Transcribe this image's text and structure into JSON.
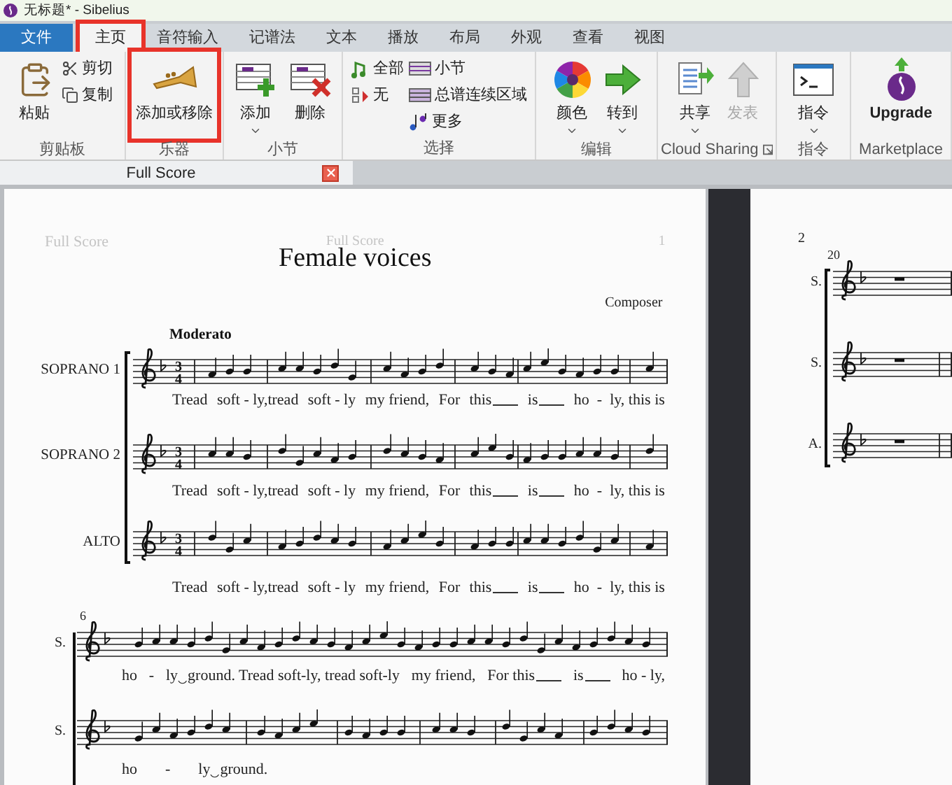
{
  "window": {
    "title": "无标题* - Sibelius"
  },
  "ribbon_tabs": [
    {
      "label": "文件",
      "kind": "file",
      "selected": false,
      "highlighted": false
    },
    {
      "label": "主页",
      "kind": "tab",
      "selected": true,
      "highlighted": true
    },
    {
      "label": "音符输入",
      "kind": "tab",
      "selected": false,
      "highlighted": false
    },
    {
      "label": "记谱法",
      "kind": "tab",
      "selected": false,
      "highlighted": false
    },
    {
      "label": "文本",
      "kind": "tab",
      "selected": false,
      "highlighted": false
    },
    {
      "label": "播放",
      "kind": "tab",
      "selected": false,
      "highlighted": false
    },
    {
      "label": "布局",
      "kind": "tab",
      "selected": false,
      "highlighted": false
    },
    {
      "label": "外观",
      "kind": "tab",
      "selected": false,
      "highlighted": false
    },
    {
      "label": "查看",
      "kind": "tab",
      "selected": false,
      "highlighted": false
    },
    {
      "label": "视图",
      "kind": "tab",
      "selected": false,
      "highlighted": false
    }
  ],
  "ribbon_groups": [
    {
      "label": "剪贴板",
      "items": [
        {
          "kind": "large",
          "label": "粘贴",
          "dropdown": false,
          "disabled": false,
          "highlighted": false
        },
        {
          "kind": "stack",
          "items": [
            {
              "label": "剪切"
            },
            {
              "label": "复制"
            }
          ]
        }
      ]
    },
    {
      "label": "乐器",
      "items": [
        {
          "kind": "large",
          "label": "添加或移除",
          "dropdown": false,
          "disabled": false,
          "highlighted": true
        }
      ]
    },
    {
      "label": "小节",
      "items": [
        {
          "kind": "large",
          "label": "添加",
          "dropdown": true,
          "disabled": false,
          "highlighted": false
        },
        {
          "kind": "large",
          "label": "删除",
          "dropdown": false,
          "disabled": false,
          "highlighted": false
        }
      ]
    },
    {
      "label": "选择",
      "items": [
        {
          "kind": "stack",
          "items": [
            {
              "label": "全部"
            },
            {
              "label": "无"
            }
          ]
        },
        {
          "kind": "stack",
          "items": [
            {
              "label": "小节"
            },
            {
              "label": "总谱连续区域"
            },
            {
              "label": "更多"
            }
          ]
        }
      ]
    },
    {
      "label": "编辑",
      "items": [
        {
          "kind": "large",
          "label": "颜色",
          "dropdown": true,
          "disabled": false,
          "highlighted": false
        },
        {
          "kind": "large",
          "label": "转到",
          "dropdown": true,
          "disabled": false,
          "highlighted": false
        }
      ]
    },
    {
      "label": "Cloud Sharing",
      "launcher": true,
      "items": [
        {
          "kind": "large",
          "label": "共享",
          "dropdown": true,
          "disabled": false,
          "highlighted": false
        },
        {
          "kind": "large",
          "label": "发表",
          "dropdown": false,
          "disabled": true,
          "highlighted": false
        }
      ]
    },
    {
      "label": "指令",
      "items": [
        {
          "kind": "large",
          "label": "指令",
          "dropdown": true,
          "disabled": false,
          "highlighted": false
        }
      ]
    },
    {
      "label": "Marketplace",
      "items": [
        {
          "kind": "large",
          "label": "Upgrade",
          "dropdown": false,
          "disabled": false,
          "highlighted": false
        }
      ]
    }
  ],
  "document_tab": {
    "label": "Full Score"
  },
  "page_1": {
    "header_left": "Full Score",
    "header_center": "Full Score",
    "page_number": "1",
    "title": "Female voices",
    "composer": "Composer",
    "tempo": "Moderato",
    "systems": [
      {
        "staves": [
          {
            "name": "SOPRANO 1",
            "time_signature": {
              "numerator": "3",
              "denominator": "4"
            },
            "lyrics": [
              {
                "text": "Tread",
                "extender": false
              },
              {
                "text": "soft - ly,tread",
                "extender": false
              },
              {
                "text": "soft - ly",
                "extender": false
              },
              {
                "text": "my friend,",
                "extender": false
              },
              {
                "text": "For",
                "extender": false
              },
              {
                "text": "this",
                "extender": true
              },
              {
                "text": "is",
                "extender": true
              },
              {
                "text": "ho  -  ly, this is",
                "extender": false
              }
            ]
          },
          {
            "name": "SOPRANO 2",
            "time_signature": {
              "numerator": "3",
              "denominator": "4"
            },
            "lyrics": [
              {
                "text": "Tread",
                "extender": false
              },
              {
                "text": "soft - ly,tread",
                "extender": false
              },
              {
                "text": "soft - ly",
                "extender": false
              },
              {
                "text": "my friend,",
                "extender": false
              },
              {
                "text": "For",
                "extender": false
              },
              {
                "text": "this",
                "extender": true
              },
              {
                "text": "is",
                "extender": true
              },
              {
                "text": "ho  -  ly, this is",
                "extender": false
              }
            ]
          },
          {
            "name": "ALTO",
            "time_signature": {
              "numerator": "3",
              "denominator": "4"
            },
            "lyrics": [
              {
                "text": "Tread",
                "extender": false
              },
              {
                "text": "soft - ly,tread",
                "extender": false
              },
              {
                "text": "soft - ly",
                "extender": false
              },
              {
                "text": "my friend,",
                "extender": false
              },
              {
                "text": "For",
                "extender": false
              },
              {
                "text": "this",
                "extender": true
              },
              {
                "text": "is",
                "extender": true
              },
              {
                "text": "ho  -  ly, this is",
                "extender": false
              }
            ]
          }
        ]
      },
      {
        "measure_number": "6",
        "staves": [
          {
            "name": "S.",
            "lyrics": [
              {
                "text": "ho",
                "extender": false
              },
              {
                "text": "-",
                "extender": false
              },
              {
                "text": "ly‿ground. Tread soft-ly, tread soft-ly",
                "extender": false
              },
              {
                "text": "my friend,",
                "extender": false
              },
              {
                "text": "For this",
                "extender": true
              },
              {
                "text": "is",
                "extender": true
              },
              {
                "text": "ho - ly,",
                "extender": false
              }
            ]
          },
          {
            "name": "S.",
            "lyrics": [
              {
                "text": "ho",
                "extender": false
              },
              {
                "text": "-",
                "extender": false
              },
              {
                "text": "ly‿ground.",
                "extender": false
              }
            ]
          }
        ]
      }
    ]
  },
  "page_2": {
    "page_number": "2",
    "measure_number": "20",
    "staves": [
      {
        "name": "S."
      },
      {
        "name": "S."
      },
      {
        "name": "A."
      }
    ]
  }
}
